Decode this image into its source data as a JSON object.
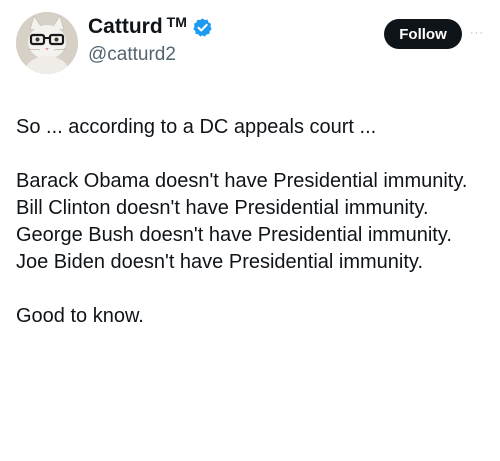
{
  "user": {
    "display_name": "Catturd",
    "trademark": "TM",
    "handle": "@catturd2",
    "follow_label": "Follow",
    "more_glyph": "···"
  },
  "tweet": {
    "intro": "So ... according to a DC appeals court ...",
    "lines": [
      "Barack Obama doesn't have Presidential immunity.",
      "Bill Clinton doesn't have Presidential immunity.",
      "George Bush doesn't have Presidential immunity.",
      "Joe Biden doesn't have Presidential immunity."
    ],
    "closing": "Good to know."
  },
  "icons": {
    "avatar": "cat-with-glasses-avatar",
    "verified": "verified-badge-icon",
    "more": "more-options-icon"
  },
  "colors": {
    "verified_blue": "#1d9bf0",
    "text": "#0f1419",
    "secondary": "#536471",
    "button": "#0f1419"
  }
}
